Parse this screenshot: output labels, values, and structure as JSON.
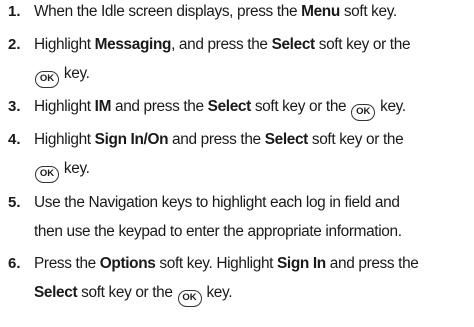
{
  "steps": [
    {
      "number": "1.",
      "lines": [
        {
          "t1": "When the Idle screen displays, press the ",
          "b1": "Menu",
          "t2": " soft key."
        }
      ]
    },
    {
      "number": "2.",
      "lines": [
        {
          "t1": "Highlight ",
          "b1": "Messaging",
          "t2": ", and press the ",
          "b2": "Select",
          "t3": " soft key or the"
        },
        {
          "ok": "OK",
          "t1": " key."
        }
      ]
    },
    {
      "number": "3.",
      "lines": [
        {
          "t1": "Highlight ",
          "b1": "IM",
          "t2": " and press the ",
          "b2": "Select",
          "t3": " soft key or the ",
          "ok": "OK",
          "t4": " key."
        }
      ]
    },
    {
      "number": "4.",
      "lines": [
        {
          "t1": "Highlight ",
          "b1": "Sign In/On",
          "t2": " and press the ",
          "b2": "Select",
          "t3": " soft key or the"
        },
        {
          "ok": "OK",
          "t1": " key."
        }
      ]
    },
    {
      "number": "5.",
      "lines": [
        {
          "t1": "Use the Navigation keys to highlight each log in field and"
        },
        {
          "t1": "then use the keypad to enter the appropriate information."
        }
      ]
    },
    {
      "number": "6.",
      "lines": [
        {
          "t1": "Press the ",
          "b1": "Options",
          "t2": " soft key. Highlight ",
          "b2": "Sign In",
          "t3": " and press the"
        },
        {
          "b1": "Select",
          "t1": " soft key or the ",
          "ok": "OK",
          "t2": " key."
        }
      ]
    }
  ]
}
